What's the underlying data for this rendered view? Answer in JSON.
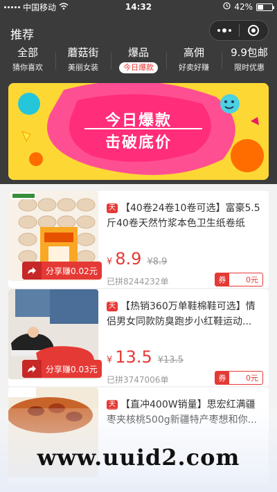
{
  "status_bar": {
    "carrier": "中国移动",
    "time": "14:32",
    "battery": "42%",
    "battery_level": 0.42
  },
  "header": {
    "title": "推荐"
  },
  "tabs": [
    {
      "label": "全部",
      "sub": "猜你喜欢",
      "active": false
    },
    {
      "label": "蘑菇街",
      "sub": "美丽女装",
      "active": false
    },
    {
      "label": "爆品",
      "sub": "今日爆款",
      "active": true
    },
    {
      "label": "高佣",
      "sub": "好卖好赚",
      "active": false
    },
    {
      "label": "9.9包邮",
      "sub": "限时优惠",
      "active": false
    }
  ],
  "banner": {
    "line1": "今日爆款",
    "line2": "击破底价"
  },
  "products": [
    {
      "title": "【40卷24卷10卷可选】富豪5.5斤40卷天然竹浆本色卫生纸卷纸",
      "yen": "¥",
      "price": "8.9",
      "old_price": "¥8.9",
      "sold": "已拼8244232单",
      "share": "分享赚0.02元",
      "coupon_label": "券",
      "coupon_value": "0元",
      "mall_icon": "天"
    },
    {
      "title": "【热销360万单鞋棉鞋可选】情侣男女同款防臭跑步小红鞋运动...",
      "yen": "¥",
      "price": "13.5",
      "old_price": "¥13.5",
      "sold": "已拼3747006单",
      "share": "分享赚0.03元",
      "coupon_label": "券",
      "coupon_value": "0元",
      "mall_icon": "天"
    },
    {
      "title": "【直冲400W销量】思宏红满疆枣夹核桃500g新疆特产枣想和你...",
      "mall_icon": "天"
    }
  ],
  "watermark": "www.uuid2.com",
  "icons": {
    "share": "share-arrow-icon",
    "menu": "more-dots-icon",
    "close": "close-target-icon",
    "wifi": "wifi-icon"
  }
}
